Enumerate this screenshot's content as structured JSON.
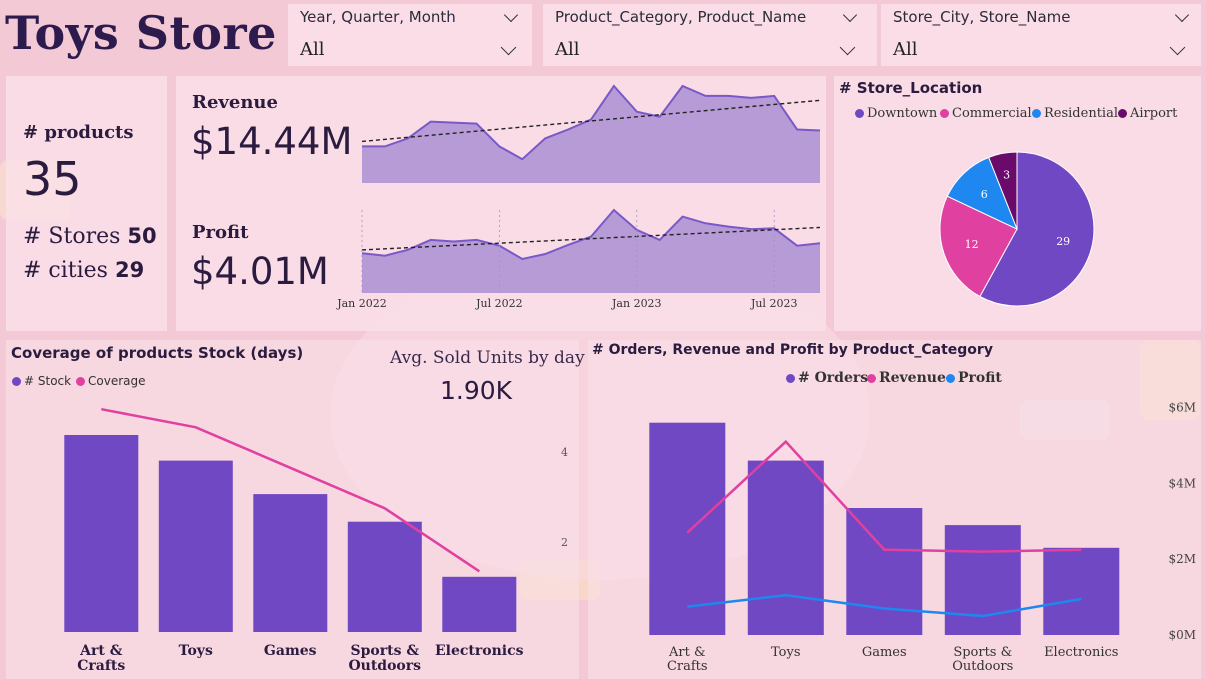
{
  "title": "Toys Store",
  "colors": {
    "purple": "#7048c4",
    "pink": "#e040a0",
    "blue": "#1e88f0",
    "darkpurple": "#6a0a6a",
    "area": "#b69bd6",
    "area_line": "#7a58c8"
  },
  "slicers": [
    {
      "label": "Year, Quarter, Month",
      "value": "All"
    },
    {
      "label": "Product_Category, Product_Name",
      "value": "All"
    },
    {
      "label": "Store_City, Store_Name",
      "value": "All"
    }
  ],
  "kpi": {
    "products_label": "# products",
    "products_value": "35",
    "stores_label": "# Stores",
    "stores_value": "50",
    "cities_label": "# cities",
    "cities_value": "29"
  },
  "revenue": {
    "label": "Revenue",
    "value": "$14.44M"
  },
  "profit": {
    "label": "Profit",
    "value": "$4.01M"
  },
  "timeline_ticks": [
    "Jan 2022",
    "Jul 2022",
    "Jan 2023",
    "Jul 2023"
  ],
  "store_location": {
    "title": "# Store_Location",
    "legend": [
      "Downtown",
      "Commercial",
      "Residential",
      "Airport"
    ]
  },
  "coverage": {
    "title": "Coverage of products Stock (days)",
    "legend": [
      "# Stock",
      "Coverage"
    ],
    "avg_label": "Avg. Sold Units by day",
    "avg_value": "1.90K"
  },
  "orders": {
    "title": "# Orders, Revenue and Profit by Product_Category",
    "legend": [
      "# Orders",
      "Revenue",
      "Profit"
    ]
  },
  "chart_data": [
    {
      "type": "area",
      "title": "Revenue",
      "x": [
        "Jan 2022",
        "Feb 2022",
        "Mar 2022",
        "Apr 2022",
        "May 2022",
        "Jun 2022",
        "Jul 2022",
        "Aug 2022",
        "Sep 2022",
        "Oct 2022",
        "Nov 2022",
        "Dec 2022",
        "Jan 2023",
        "Feb 2023",
        "Mar 2023",
        "Apr 2023",
        "May 2023",
        "Jun 2023",
        "Jul 2023",
        "Aug 2023",
        "Sep 2023"
      ],
      "xticks": [
        "Jan 2022",
        "Jul 2022",
        "Jan 2023",
        "Jul 2023"
      ],
      "series": [
        {
          "values": [
            0.37,
            0.37,
            0.45,
            0.62,
            0.61,
            0.6,
            0.37,
            0.24,
            0.45,
            0.54,
            0.64,
            0.98,
            0.72,
            0.67,
            0.98,
            0.88,
            0.88,
            0.86,
            0.88,
            0.54,
            0.53
          ]
        }
      ],
      "trendline": true,
      "ylim": [
        0,
        1
      ]
    },
    {
      "type": "area",
      "title": "Profit",
      "x": [
        "Jan 2022",
        "Feb 2022",
        "Mar 2022",
        "Apr 2022",
        "May 2022",
        "Jun 2022",
        "Jul 2022",
        "Aug 2022",
        "Sep 2022",
        "Oct 2022",
        "Nov 2022",
        "Dec 2022",
        "Jan 2023",
        "Feb 2023",
        "Mar 2023",
        "Apr 2023",
        "May 2023",
        "Jun 2023",
        "Jul 2023",
        "Aug 2023",
        "Sep 2023"
      ],
      "xticks": [
        "Jan 2022",
        "Jul 2022",
        "Jan 2023",
        "Jul 2023"
      ],
      "series": [
        {
          "values": [
            0.48,
            0.45,
            0.52,
            0.64,
            0.62,
            0.64,
            0.57,
            0.41,
            0.47,
            0.58,
            0.68,
            1.0,
            0.76,
            0.64,
            0.92,
            0.84,
            0.8,
            0.77,
            0.78,
            0.57,
            0.6
          ]
        }
      ],
      "trendline": true,
      "ylim": [
        0,
        1
      ]
    },
    {
      "type": "pie",
      "title": "# Store_Location",
      "categories": [
        "Downtown",
        "Commercial",
        "Residential",
        "Airport"
      ],
      "values": [
        29,
        12,
        6,
        3
      ],
      "colors": [
        "#7048c4",
        "#e040a0",
        "#1e88f0",
        "#6a0a6a"
      ]
    },
    {
      "type": "bar",
      "title": "Coverage of products Stock (days)",
      "categories": [
        "Art & Crafts",
        "Toys",
        "Games",
        "Sports & Outdoors",
        "Electronics"
      ],
      "series": [
        {
          "name": "# Stock",
          "values": [
            100,
            87,
            70,
            56,
            28
          ]
        },
        {
          "name": "Coverage",
          "values": [
            4.95,
            4.55,
            3.65,
            2.75,
            1.35
          ]
        }
      ],
      "y2ticks": [
        "4",
        "2"
      ],
      "y2lim": [
        0,
        5.6
      ]
    },
    {
      "type": "bar",
      "title": "# Orders, Revenue and Profit by Product_Category",
      "categories": [
        "Art & Crafts",
        "Toys",
        "Games",
        "Sports & Outdoors",
        "Electronics"
      ],
      "series": [
        {
          "name": "# Orders",
          "values": [
            5.6,
            4.6,
            3.35,
            2.9,
            2.3
          ]
        },
        {
          "name": "Revenue",
          "values": [
            2.7,
            5.1,
            2.25,
            2.2,
            2.25
          ]
        },
        {
          "name": "Profit",
          "values": [
            0.75,
            1.05,
            0.7,
            0.5,
            0.95
          ]
        }
      ],
      "y2ticks": [
        "$6M",
        "$4M",
        "$2M",
        "$0M"
      ],
      "y2lim": [
        0,
        6.2
      ]
    }
  ]
}
